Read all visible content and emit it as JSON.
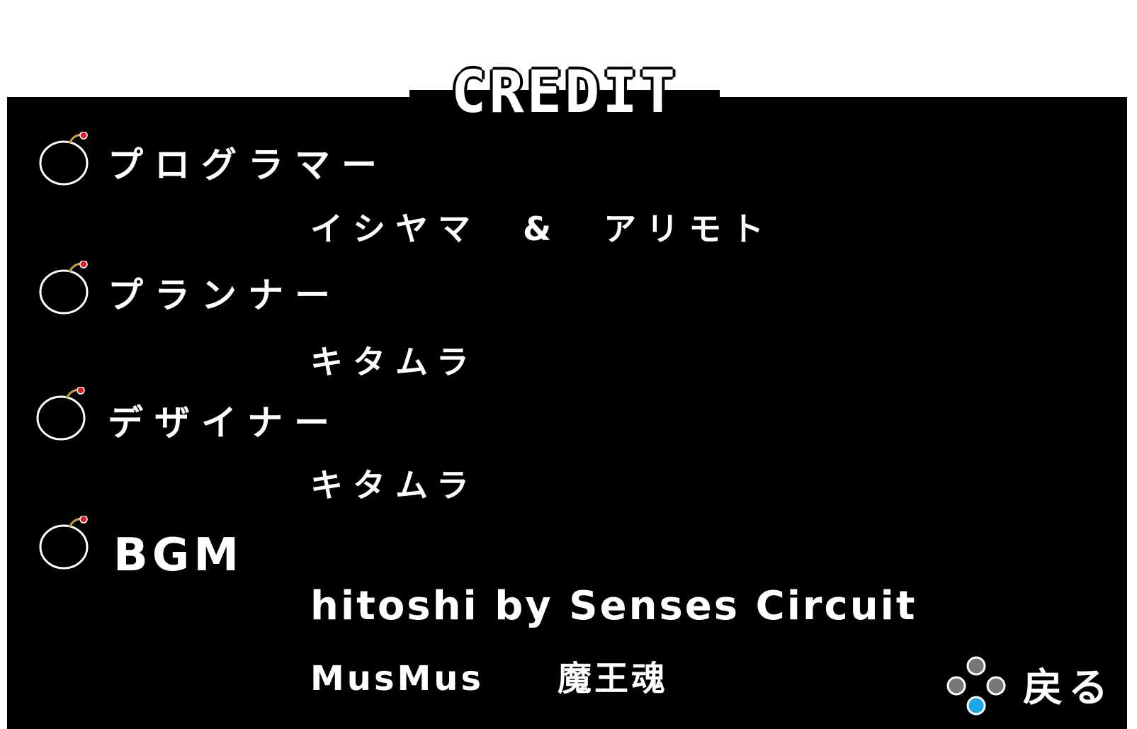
{
  "screen": {
    "title": "CREDIT"
  },
  "credits": [
    {
      "role": "プログラマー",
      "names": [
        "イシヤマ　&　アリモト"
      ]
    },
    {
      "role": "プランナー",
      "names": [
        "キタムラ"
      ]
    },
    {
      "role": "デザイナー",
      "names": [
        "キタムラ"
      ]
    },
    {
      "role": "BGM",
      "names": [
        "hitoshi by Senses Circuit",
        "MusMus　　魔王魂"
      ]
    }
  ],
  "back_button": {
    "label": "戻る",
    "icon": "dpad-buttons-icon",
    "highlight_color": "#1aa7e8",
    "button_color": "#777777"
  },
  "colors": {
    "panel": "#000000",
    "background": "#ffffff",
    "text": "#ffffff",
    "bomb_fuse_spark": "#e02020",
    "bomb_fuse": "#c8a040"
  }
}
